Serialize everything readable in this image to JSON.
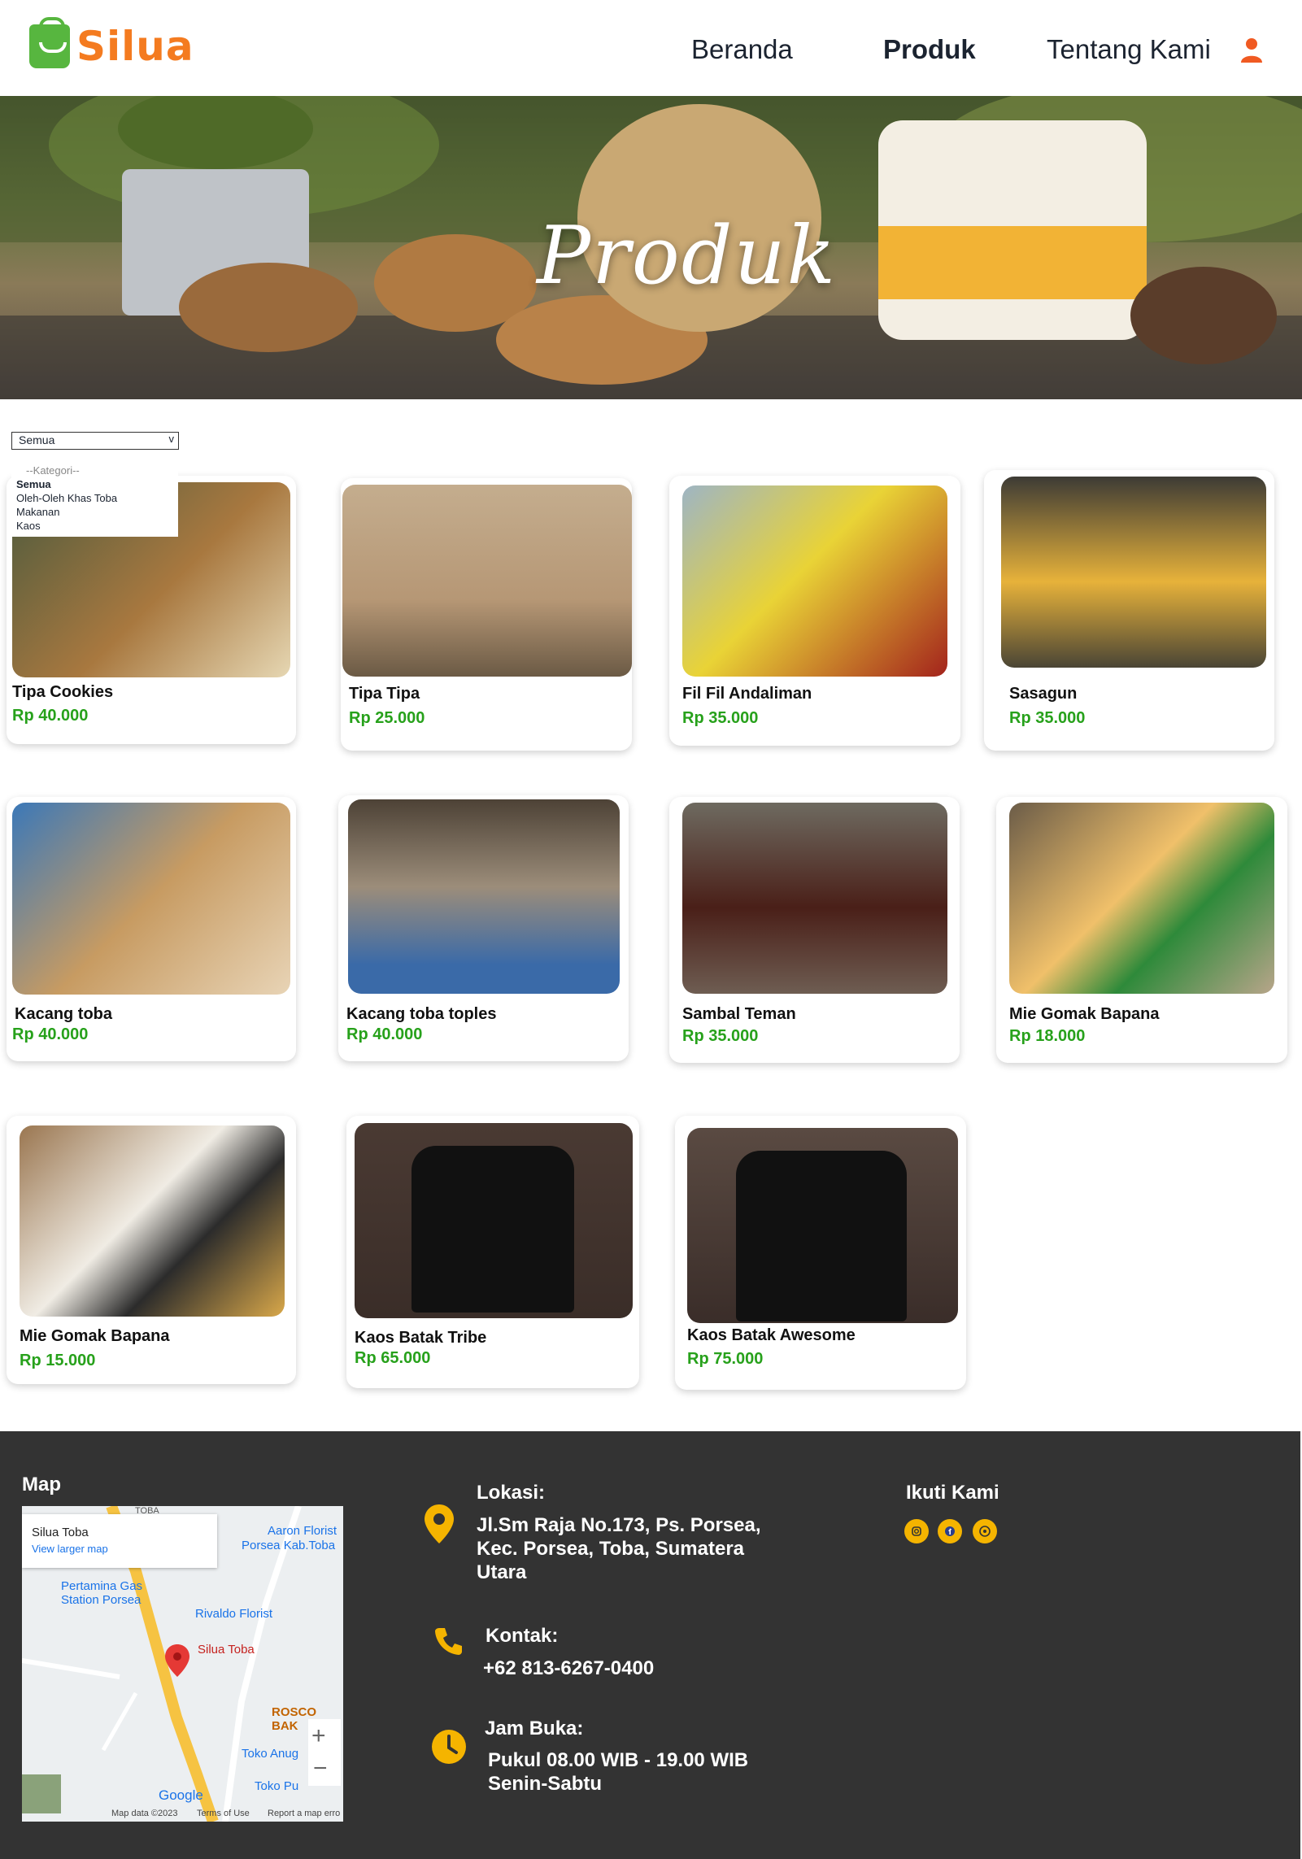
{
  "header": {
    "logo_text": "Silua",
    "nav": [
      "Beranda",
      "Produk",
      "Tentang Kami"
    ],
    "active": "Produk"
  },
  "hero": {
    "title": "Produk"
  },
  "filter": {
    "selected": "Semua",
    "options": [
      "--Kategori--",
      "Semua",
      "Oleh-Oleh Khas Toba",
      "Makanan",
      "Kaos"
    ]
  },
  "products": [
    {
      "name": "Tipa Cookies",
      "price": "Rp 40.000"
    },
    {
      "name": "Tipa Tipa",
      "price": "Rp 25.000"
    },
    {
      "name": "Fil Fil Andaliman",
      "price": "Rp 35.000"
    },
    {
      "name": "Sasagun",
      "price": "Rp 35.000"
    },
    {
      "name": "Kacang toba",
      "price": "Rp 40.000"
    },
    {
      "name": "Kacang toba toples",
      "price": "Rp 40.000"
    },
    {
      "name": "Sambal Teman",
      "price": "Rp 35.000"
    },
    {
      "name": "Mie Gomak Bapana",
      "price": "Rp 18.000"
    },
    {
      "name": "Mie Gomak Bapana",
      "price": "Rp 15.000"
    },
    {
      "name": "Kaos Batak Tribe",
      "price": "Rp 65.000"
    },
    {
      "name": "Kaos Batak Awesome",
      "price": "Rp 75.000"
    }
  ],
  "footer": {
    "map_heading": "Map",
    "map": {
      "place": "Silua Toba",
      "larger": "View larger map",
      "labels": [
        "Aaron Florist",
        "Porsea Kab.Toba",
        "Pertamina Gas",
        "Station Porsea",
        "Rivaldo Florist",
        "Silua Toba",
        "ROSCO BAK",
        "Toko Anug",
        "Toko Pu",
        "Google",
        "Map data ©2023",
        "Terms of Use",
        "Report a map erro",
        "TOBA"
      ]
    },
    "lokasi_heading": "Lokasi:",
    "lokasi_lines": [
      "Jl.Sm Raja No.173, Ps. Porsea,",
      "Kec. Porsea, Toba, Sumatera",
      "Utara"
    ],
    "kontak_heading": "Kontak:",
    "kontak_value": "+62 813-6267-0400",
    "jam_heading": "Jam Buka:",
    "jam_lines": [
      "Pukul 08.00 WIB - 19.00 WIB",
      "Senin-Sabtu"
    ],
    "ikuti_heading": "Ikuti Kami",
    "social_icons": [
      "instagram-icon",
      "facebook-icon",
      "whatsapp-icon"
    ]
  },
  "colors": {
    "brand_orange": "#f47b20",
    "brand_green": "#57b63f",
    "price_green": "#27a11b",
    "footer_bg": "#333333",
    "accent_yellow": "#f5b400"
  }
}
